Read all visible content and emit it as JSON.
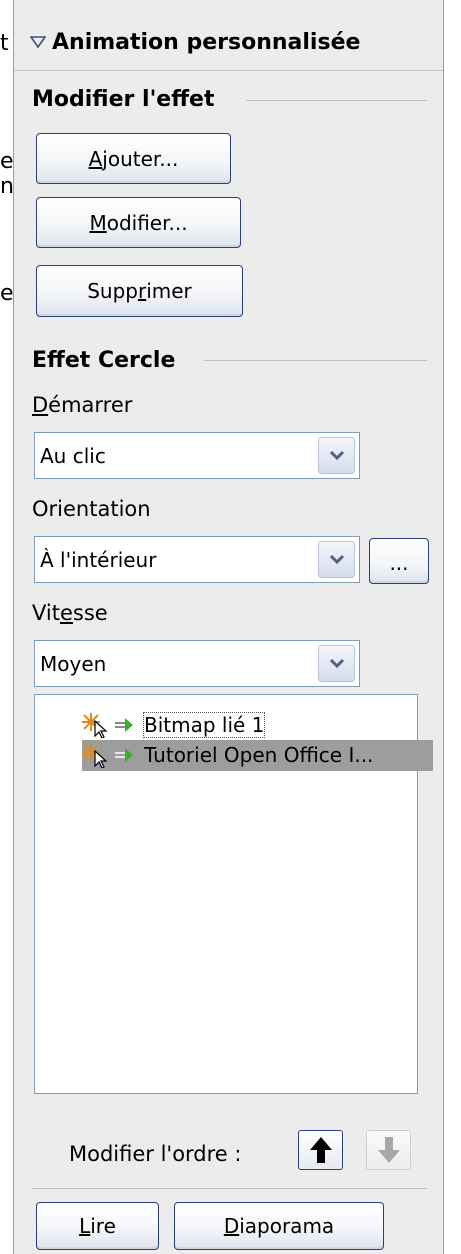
{
  "cut_text": [
    "t",
    "es",
    "n",
    "es"
  ],
  "panel": {
    "title": "Animation personnalisée",
    "collapse_icon": "triangle-down-icon"
  },
  "modify_group": {
    "label": "Modifier l'effet",
    "add_button": {
      "pre": "",
      "key": "A",
      "post": "jouter..."
    },
    "change_button": {
      "pre": "",
      "key": "M",
      "post": "odifier..."
    },
    "remove_button": {
      "pre": "Supp",
      "key": "r",
      "post": "imer"
    }
  },
  "effect_group": {
    "label": "Effet Cercle",
    "start": {
      "label_pre": "",
      "label_key": "D",
      "label_post": "émarrer",
      "value": "Au clic"
    },
    "direction": {
      "label": "Orientation",
      "value": "À l'intérieur",
      "options_button": "..."
    },
    "speed": {
      "label_pre": "Vit",
      "label_key": "e",
      "label_post": "sse",
      "value": "Moyen"
    }
  },
  "effects_list": [
    {
      "text": "Bitmap lié 1",
      "selected": false,
      "icons": [
        "star-burst-icon",
        "cursor-icon",
        "entrance-arrow-icon"
      ]
    },
    {
      "text": "Tutoriel Open Office I...",
      "selected": true,
      "icons": [
        "star-burst-icon",
        "cursor-icon",
        "entrance-arrow-icon"
      ]
    }
  ],
  "order": {
    "label": "Modifier l'ordre :",
    "up_icon": "arrow-up-icon",
    "down_icon": "arrow-down-icon"
  },
  "footer": {
    "play_button": {
      "key": "L",
      "post": "ire"
    },
    "slideshow_button": {
      "key": "D",
      "post": "iaporama"
    }
  }
}
